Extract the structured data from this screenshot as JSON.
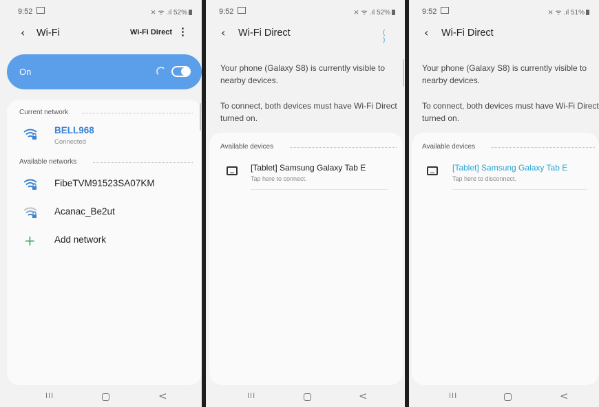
{
  "screens": [
    {
      "status_time": "9:52",
      "status_right": "⨯ ᯤ .ıl 52%",
      "title": "Wi-Fi",
      "top_action": "Wi-Fi Direct",
      "toggle_label": "On",
      "current_section": "Current network",
      "current_network": {
        "name": "BELL968",
        "status": "Connected"
      },
      "available_section": "Available networks",
      "networks": [
        {
          "name": "FibeTVM91523SA07KM"
        },
        {
          "name": "Acanac_Be2ut"
        }
      ],
      "add_network": "Add network"
    },
    {
      "status_time": "9:52",
      "status_right": "⨯ ᯤ .ıl 52%",
      "title": "Wi-Fi Direct",
      "visible_text": "Your phone (Galaxy S8) is currently visible to nearby devices.",
      "connect_text": "To connect, both devices must have Wi-Fi Direct turned on.",
      "devices_section": "Available devices",
      "device": {
        "name": "[Tablet] Samsung Galaxy Tab E",
        "hint": "Tap here to connect."
      }
    },
    {
      "status_time": "9:52",
      "status_right": "⨯ ᯤ .ıl 51%",
      "title": "Wi-Fi Direct",
      "visible_text": "Your phone (Galaxy S8) is currently visible to nearby devices.",
      "connect_text": "To connect, both devices must have Wi-Fi Direct turned on.",
      "devices_section": "Available devices",
      "device": {
        "name": "[Tablet] Samsung Galaxy Tab E",
        "hint": "Tap here to disconnect."
      }
    }
  ],
  "nav": {
    "recent": "III",
    "home": "",
    "back": "<"
  },
  "icons": {
    "back": "chevron-left-icon",
    "wifi": "wifi-lock-icon",
    "tablet": "tablet-icon",
    "add": "plus-icon"
  },
  "colors": {
    "toggle_bar": "#5b9ee9",
    "active_network": "#3c83d1",
    "connected_device": "#29a6d1",
    "add_icon": "#39a96b",
    "background": "#f2f2f2",
    "card": "#fafafa"
  }
}
